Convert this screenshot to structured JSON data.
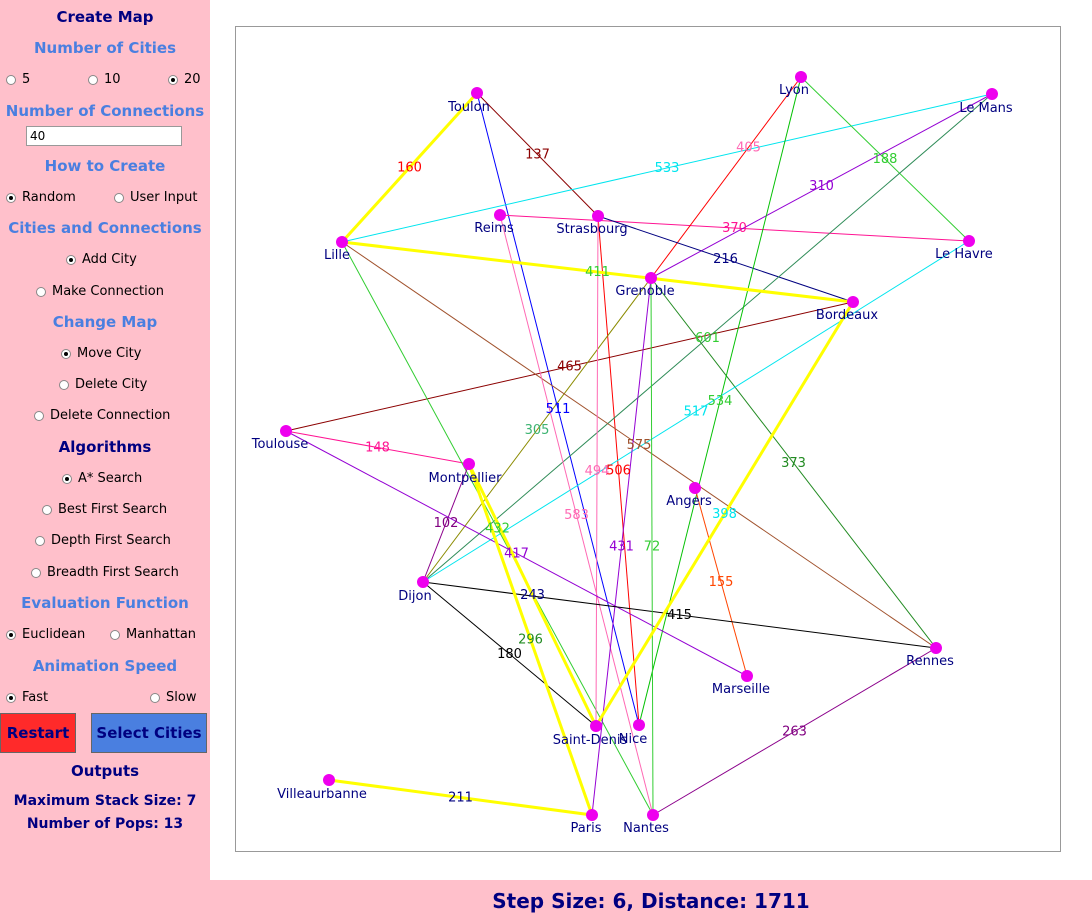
{
  "sidebar": {
    "create_map": "Create Map",
    "num_cities_title": "Number of Cities",
    "num_cities_options": [
      "5",
      "10",
      "20"
    ],
    "num_connections_title": "Number of Connections",
    "num_connections_value": "40",
    "how_to_create_title": "How to Create",
    "how_to_create_options": [
      "Random",
      "User Input"
    ],
    "cities_connections_title": "Cities and Connections",
    "add_city": "Add City",
    "make_connection": "Make Connection",
    "change_map_title": "Change Map",
    "move_city": "Move City",
    "delete_city": "Delete City",
    "delete_connection": "Delete Connection",
    "algorithms_title": "Algorithms",
    "astar": "A* Search",
    "best_first": "Best First Search",
    "depth_first": "Depth First Search",
    "breadth_first": "Breadth First Search",
    "evaluation_title": "Evaluation Function",
    "euclidean": "Euclidean",
    "manhattan": "Manhattan",
    "animation_title": "Animation Speed",
    "fast": "Fast",
    "slow": "Slow",
    "restart": "Restart",
    "select_cities": "Select Cities",
    "outputs_title": "Outputs",
    "max_stack": "Maximum Stack Size: 7",
    "num_pops": "Number of Pops: 13"
  },
  "status": "Step Size: 6, Distance: 1711",
  "colors": {
    "node": "#ee00ee",
    "label": "#000080",
    "path": "#ffff00"
  },
  "map": {
    "cities": [
      {
        "name": "Toulon"
      },
      {
        "name": "Lyon"
      },
      {
        "name": "Le Mans"
      },
      {
        "name": "Reims"
      },
      {
        "name": "Strasbourg"
      },
      {
        "name": "Lille"
      },
      {
        "name": "Le Havre"
      },
      {
        "name": "Grenoble"
      },
      {
        "name": "Bordeaux"
      },
      {
        "name": "Toulouse"
      },
      {
        "name": "Montpellier"
      },
      {
        "name": "Angers"
      },
      {
        "name": "Dijon"
      },
      {
        "name": "Rennes"
      },
      {
        "name": "Marseille"
      },
      {
        "name": "Saint-Denis"
      },
      {
        "name": "Nice"
      },
      {
        "name": "Villeaurbanne"
      },
      {
        "name": "Paris"
      },
      {
        "name": "Nantes"
      }
    ],
    "edges": [
      {
        "a": "Toulon",
        "b": "Lille",
        "color": "#ffff00",
        "label": "160",
        "lc": "#ff0000",
        "path": true
      },
      {
        "a": "Toulon",
        "b": "Strasbourg",
        "color": "#8b0000",
        "label": "137",
        "lc": "#8b0000"
      },
      {
        "a": "Toulon",
        "b": "Nice",
        "color": "#0000ff",
        "label": "511",
        "lc": "#0000ff"
      },
      {
        "a": "Lille",
        "b": "Le Mans",
        "color": "#00e5ee",
        "label": "533",
        "lc": "#00e5ee"
      },
      {
        "a": "Reims",
        "b": "Le Havre",
        "color": "#ff1493",
        "label": "370",
        "lc": "#ff1493"
      },
      {
        "a": "Lyon",
        "b": "Le Havre",
        "color": "#32cd32",
        "label": "188",
        "lc": "#32cd32"
      },
      {
        "a": "Lyon",
        "b": "Grenoble",
        "color": "#ff0000",
        "label": "405",
        "lc": "#ff69b4"
      },
      {
        "a": "Le Mans",
        "b": "Grenoble",
        "color": "#9400d3",
        "label": "310",
        "lc": "#9400d3"
      },
      {
        "a": "Strasbourg",
        "b": "Bordeaux",
        "color": "#000080",
        "label": "216",
        "lc": "#000080"
      },
      {
        "a": "Lille",
        "b": "Bordeaux",
        "color": "#ffff00",
        "label": "411",
        "lc": "#32cd32",
        "path": true
      },
      {
        "a": "Strasbourg",
        "b": "Nice",
        "color": "#ff0000",
        "label": "506",
        "lc": "#ff0000"
      },
      {
        "a": "Bordeaux",
        "b": "Toulouse",
        "color": "#8b0000",
        "label": "465",
        "lc": "#8b0000"
      },
      {
        "a": "Le Mans",
        "b": "Dijon",
        "color": "#2e8b57",
        "label": "601",
        "lc": "#32cd32"
      },
      {
        "a": "Grenoble",
        "b": "Rennes",
        "color": "#228b22",
        "label": "373",
        "lc": "#228b22"
      },
      {
        "a": "Lyon",
        "b": "Nice",
        "color": "#00c000",
        "label": "534",
        "lc": "#32cd32"
      },
      {
        "a": "Le Havre",
        "b": "Dijon",
        "color": "#00e5ee",
        "label": "517",
        "lc": "#00e5ee"
      },
      {
        "a": "Grenoble",
        "b": "Dijon",
        "color": "#8b8b00",
        "label": "305",
        "lc": "#3cb371"
      },
      {
        "a": "Lille",
        "b": "Rennes",
        "color": "#a0522d",
        "label": "575",
        "lc": "#a0522d"
      },
      {
        "a": "Reims",
        "b": "Nantes",
        "color": "#ff69b4",
        "label": "583",
        "lc": "#ff69b4"
      },
      {
        "a": "Toulouse",
        "b": "Montpellier",
        "color": "#ff1493",
        "label": "148",
        "lc": "#ff1493"
      },
      {
        "a": "Lille",
        "b": "Nantes",
        "color": "#32cd32",
        "label": "432",
        "lc": "#32cd32"
      },
      {
        "a": "Strasbourg",
        "b": "Saint-Denis",
        "color": "#ff69b4",
        "label": "494",
        "lc": "#ff69b4"
      },
      {
        "a": "Angers",
        "b": "Marseille",
        "color": "#ff4500",
        "label": "155",
        "lc": "#ff4500"
      },
      {
        "a": "Grenoble",
        "b": "Paris",
        "color": "#9400d3",
        "label": "431",
        "lc": "#9400d3"
      },
      {
        "a": "Bordeaux",
        "b": "Saint-Denis",
        "color": "#ffff00",
        "label": "398",
        "lc": "#00e5ee",
        "path": true
      },
      {
        "a": "Montpellier",
        "b": "Dijon",
        "color": "#8b008b",
        "label": "102",
        "lc": "#800080"
      },
      {
        "a": "Toulouse",
        "b": "Marseille",
        "color": "#9400d3",
        "label": "417",
        "lc": "#9400d3"
      },
      {
        "a": "Montpellier",
        "b": "Saint-Denis",
        "color": "#ffff00",
        "label": "243",
        "lc": "#000080",
        "path": true
      },
      {
        "a": "Dijon",
        "b": "Rennes",
        "color": "#000000",
        "label": "415",
        "lc": "#000000"
      },
      {
        "a": "Montpellier",
        "b": "Paris",
        "color": "#ffff00",
        "label": "296",
        "lc": "#228b22",
        "path": true
      },
      {
        "a": "Dijon",
        "b": "Saint-Denis",
        "color": "#000000",
        "label": "180",
        "lc": "#000000"
      },
      {
        "a": "Rennes",
        "b": "Nantes",
        "color": "#8b008b",
        "label": "263",
        "lc": "#800080"
      },
      {
        "a": "Grenoble",
        "b": "Nantes",
        "color": "#32cd32",
        "label": "72",
        "lc": "#32cd32"
      },
      {
        "a": "Villeaurbanne",
        "b": "Paris",
        "color": "#ffff00",
        "label": "211",
        "lc": "#000080",
        "path": true
      }
    ]
  }
}
